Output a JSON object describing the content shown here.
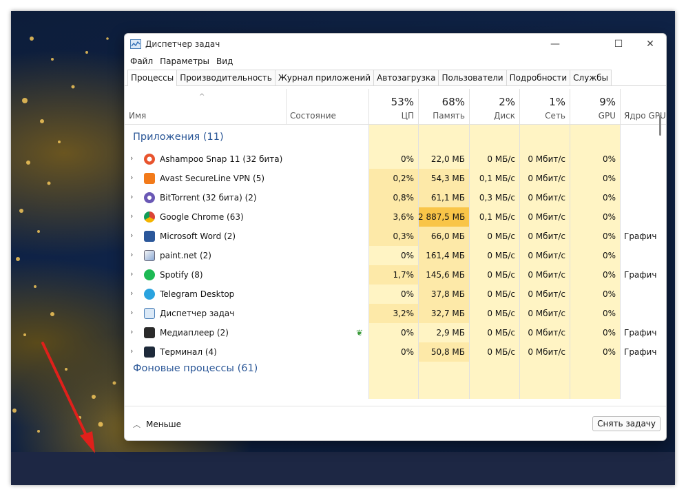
{
  "window": {
    "title": "Диспетчер задач",
    "menu": [
      "Файл",
      "Параметры",
      "Вид"
    ],
    "tabs": [
      "Процессы",
      "Производительность",
      "Журнал приложений",
      "Автозагрузка",
      "Пользователи",
      "Подробности",
      "Службы"
    ],
    "active_tab": "Процессы"
  },
  "columns": {
    "name": "Имя",
    "status": "Состояние",
    "cpu": {
      "label": "ЦП",
      "total": "53%"
    },
    "memory": {
      "label": "Память",
      "total": "68%"
    },
    "disk": {
      "label": "Диск",
      "total": "2%"
    },
    "network": {
      "label": "Сеть",
      "total": "1%"
    },
    "gpu": {
      "label": "GPU",
      "total": "9%"
    },
    "gpu_engine": {
      "label": "Ядро GPU"
    }
  },
  "groups": {
    "apps": "Приложения (11)",
    "background": "Фоновые процессы (61)"
  },
  "apps": [
    {
      "name": "Ashampoo Snap 11 (32 бита)",
      "icon": "ashampoo-snap-icon",
      "status": "",
      "cpu": "0%",
      "memory": "22,0 МБ",
      "disk": "0 МБ/с",
      "network": "0 Мбит/с",
      "gpu": "0%",
      "gpu_engine": ""
    },
    {
      "name": "Avast SecureLine VPN (5)",
      "icon": "avast-vpn-icon",
      "status": "",
      "cpu": "0,2%",
      "memory": "54,3 МБ",
      "disk": "0,1 МБ/с",
      "network": "0 Мбит/с",
      "gpu": "0%",
      "gpu_engine": ""
    },
    {
      "name": "BitTorrent (32 бита) (2)",
      "icon": "bittorrent-icon",
      "status": "",
      "cpu": "0,8%",
      "memory": "61,1 МБ",
      "disk": "0,3 МБ/с",
      "network": "0 Мбит/с",
      "gpu": "0%",
      "gpu_engine": ""
    },
    {
      "name": "Google Chrome (63)",
      "icon": "chrome-icon",
      "status": "",
      "cpu": "3,6%",
      "memory": "2 887,5 МБ",
      "disk": "0,1 МБ/с",
      "network": "0 Мбит/с",
      "gpu": "0%",
      "gpu_engine": ""
    },
    {
      "name": "Microsoft Word (2)",
      "icon": "word-icon",
      "status": "",
      "cpu": "0,3%",
      "memory": "66,0 МБ",
      "disk": "0 МБ/с",
      "network": "0 Мбит/с",
      "gpu": "0%",
      "gpu_engine": "Графич"
    },
    {
      "name": "paint.net (2)",
      "icon": "paintnet-icon",
      "status": "",
      "cpu": "0%",
      "memory": "161,4 МБ",
      "disk": "0 МБ/с",
      "network": "0 Мбит/с",
      "gpu": "0%",
      "gpu_engine": ""
    },
    {
      "name": "Spotify (8)",
      "icon": "spotify-icon",
      "status": "",
      "cpu": "1,7%",
      "memory": "145,6 МБ",
      "disk": "0 МБ/с",
      "network": "0 Мбит/с",
      "gpu": "0%",
      "gpu_engine": "Графич"
    },
    {
      "name": "Telegram Desktop",
      "icon": "telegram-icon",
      "status": "",
      "cpu": "0%",
      "memory": "37,8 МБ",
      "disk": "0 МБ/с",
      "network": "0 Мбит/с",
      "gpu": "0%",
      "gpu_engine": ""
    },
    {
      "name": "Диспетчер задач",
      "icon": "task-manager-icon",
      "status": "",
      "cpu": "3,2%",
      "memory": "32,7 МБ",
      "disk": "0 МБ/с",
      "network": "0 Мбит/с",
      "gpu": "0%",
      "gpu_engine": ""
    },
    {
      "name": "Медиаплеер (2)",
      "icon": "media-player-icon",
      "status": "eco-leaf-icon",
      "cpu": "0%",
      "memory": "2,9 МБ",
      "disk": "0 МБ/с",
      "network": "0 Мбит/с",
      "gpu": "0%",
      "gpu_engine": "Графич"
    },
    {
      "name": "Терминал (4)",
      "icon": "terminal-icon",
      "status": "",
      "cpu": "0%",
      "memory": "50,8 МБ",
      "disk": "0 МБ/с",
      "network": "0 Мбит/с",
      "gpu": "0%",
      "gpu_engine": "Графич"
    }
  ],
  "footer": {
    "less_label": "Меньше",
    "end_task_label": "Снять задачу"
  },
  "colors": {
    "group_text": "#2b5797",
    "heat_low": "#fff4c4",
    "heat_mid": "#fde9a8",
    "heat_high": "#f9c548",
    "arrow": "#e0201b"
  }
}
